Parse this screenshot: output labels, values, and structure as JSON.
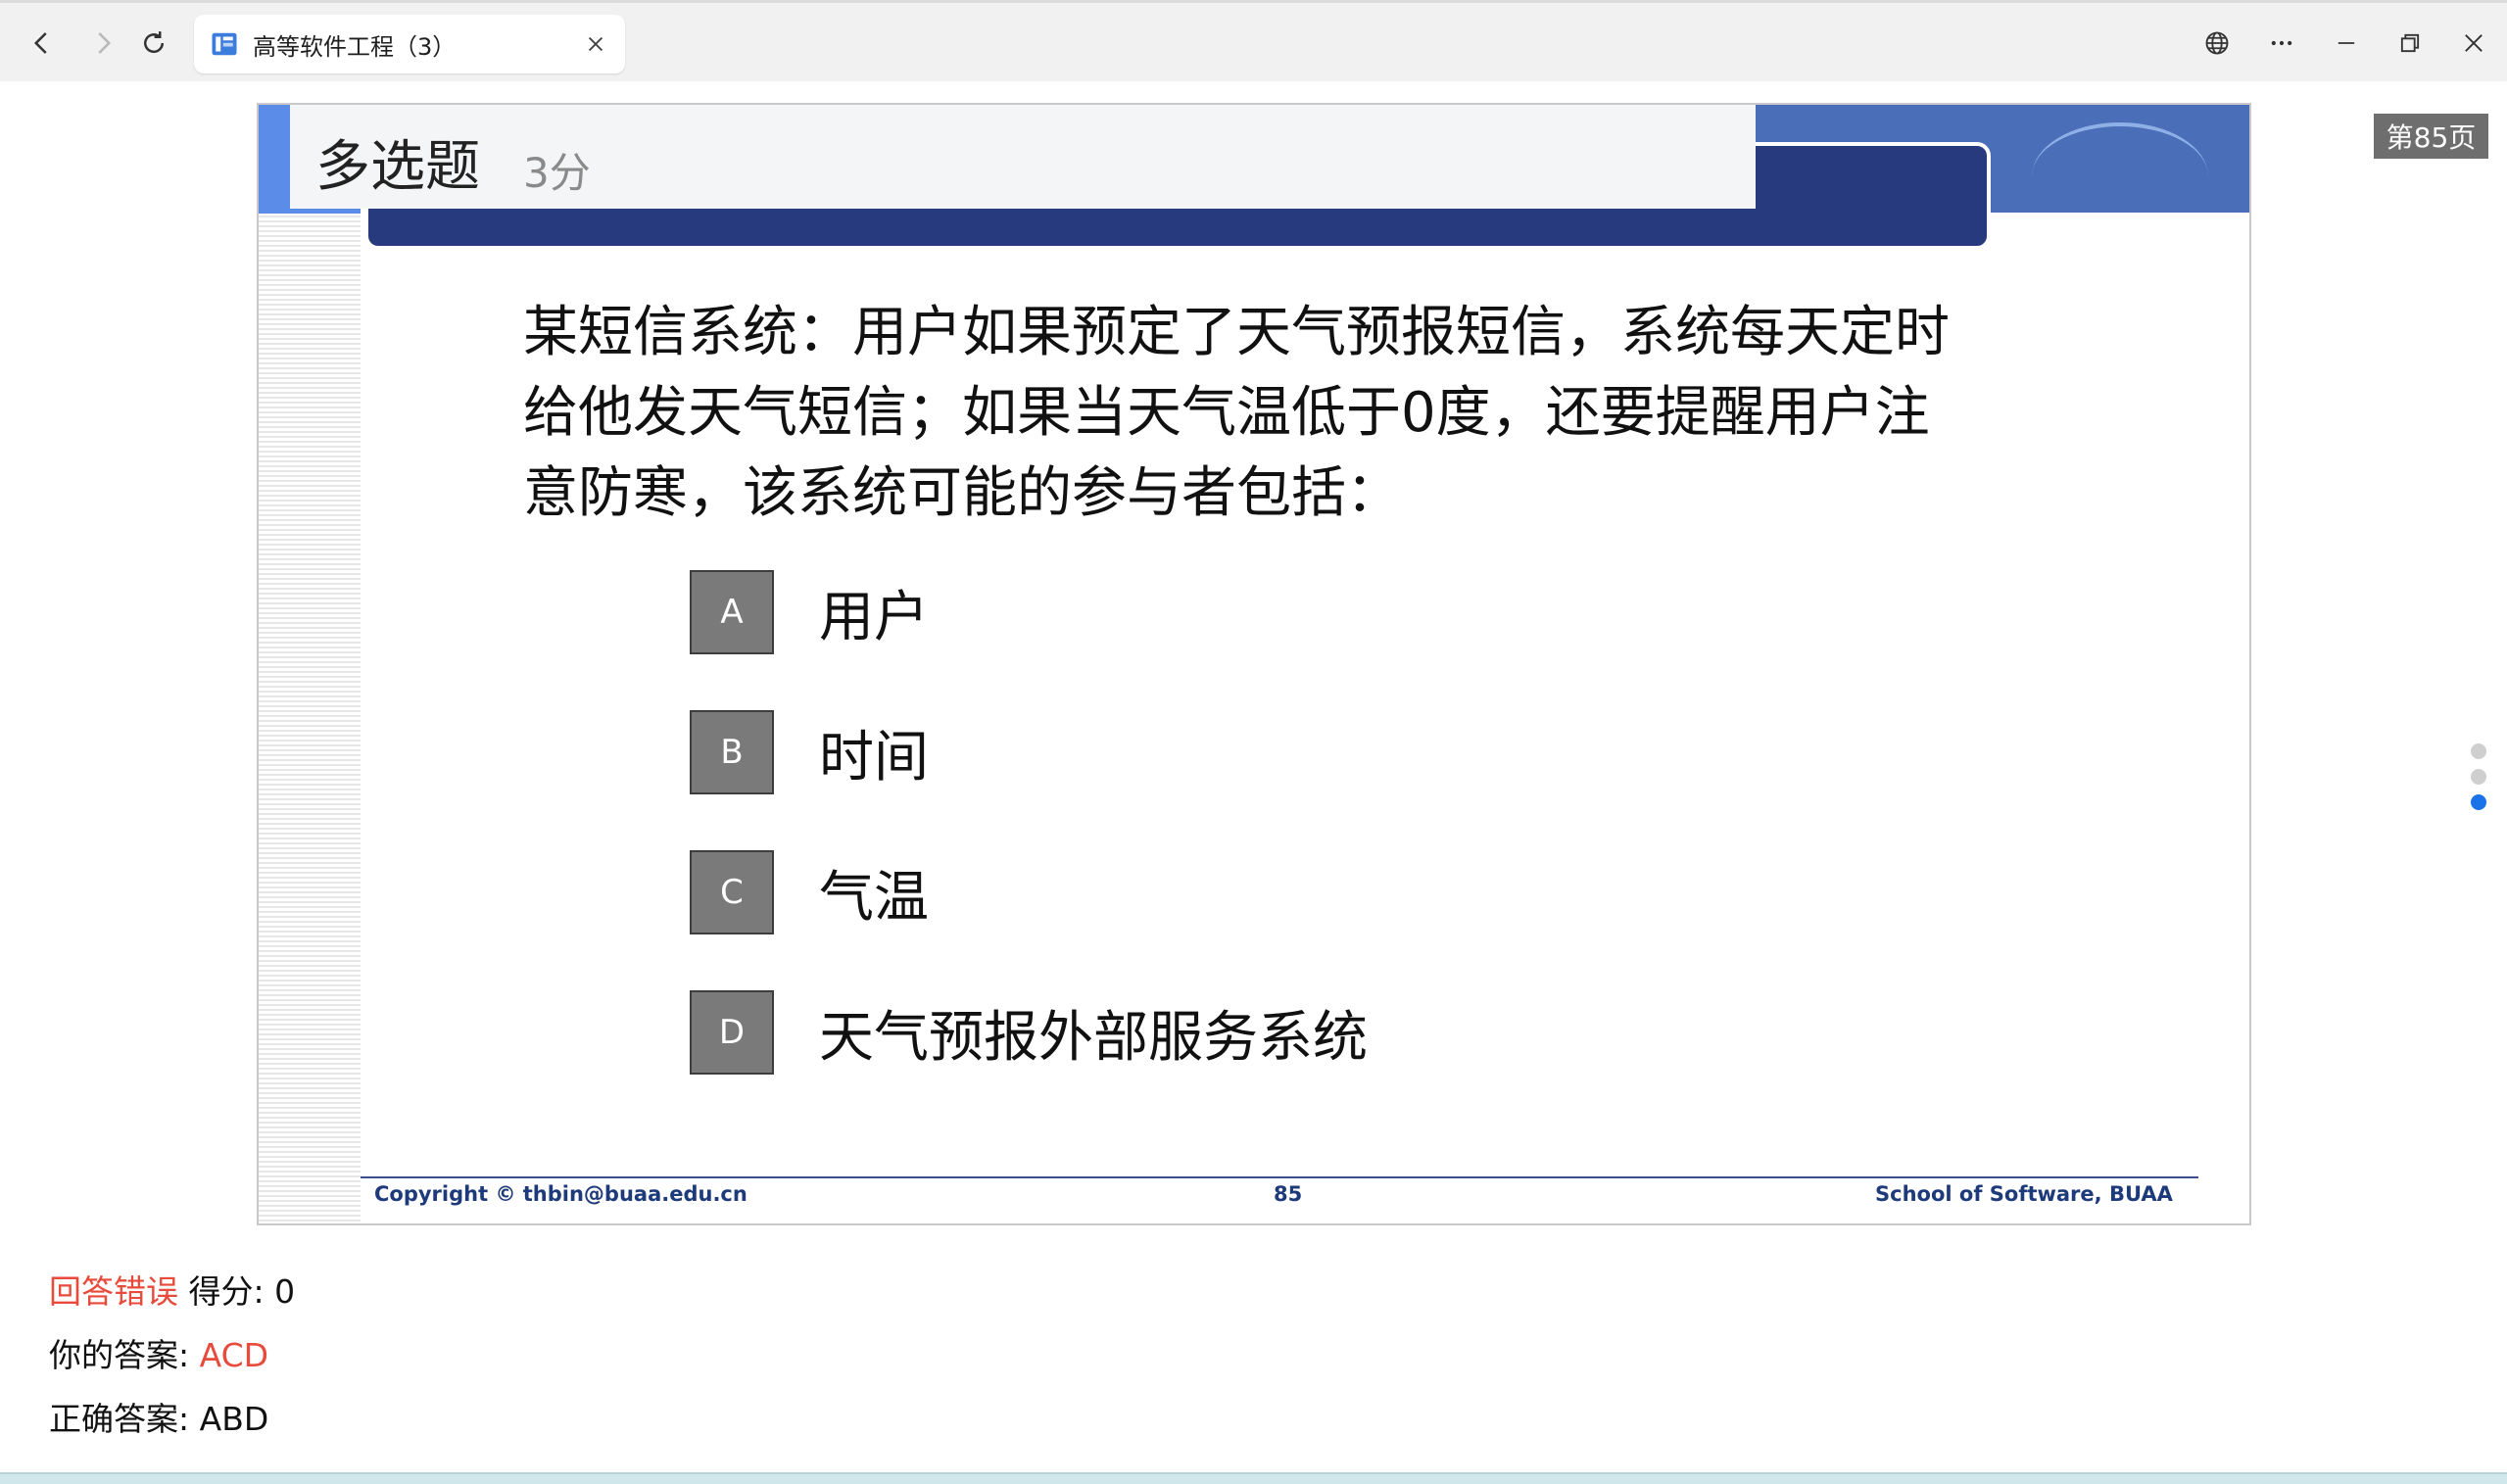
{
  "browser": {
    "tab_title": "高等软件工程（3）",
    "icons": {
      "back": "back-arrow-icon",
      "forward": "forward-arrow-icon",
      "reload": "reload-icon",
      "favicon": "document-favicon-icon",
      "close_tab": "close-icon",
      "language": "globe-icon",
      "more": "more-horizontal-icon",
      "minimize": "minimize-icon",
      "restore": "restore-window-icon",
      "close_window": "close-icon"
    }
  },
  "slide": {
    "question_type": "多选题",
    "score": "3分",
    "question_lines": [
      "某短信系统：用户如果预定了天气预报短信，系统每天定时",
      "给他发天气短信；如果当天气温低于0度，还要提醒用户注",
      "意防寒，该系统可能的参与者包括："
    ],
    "options": [
      {
        "letter": "A",
        "text": "用户"
      },
      {
        "letter": "B",
        "text": "时间"
      },
      {
        "letter": "C",
        "text": "气温"
      },
      {
        "letter": "D",
        "text": "天气预报外部服务系统"
      }
    ],
    "footer": {
      "left": "Copyright © thbin@buaa.edu.cn",
      "center": "85",
      "right": "School of Software, BUAA"
    },
    "colors": {
      "header_dark": "#263a7d",
      "header_blue": "#4a6fb8",
      "accent": "#5b8ce8",
      "option_box": "#7a7a7a"
    }
  },
  "page_badge": "第85页",
  "pager": {
    "count": 3,
    "active_index": 2
  },
  "result": {
    "status": "回答错误",
    "score_label": "得分: 0",
    "your_answer_label": "你的答案:",
    "your_answer": "ACD",
    "correct_answer_label": "正确答案:",
    "correct_answer": "ABD",
    "error_color": "#e84a3b"
  }
}
